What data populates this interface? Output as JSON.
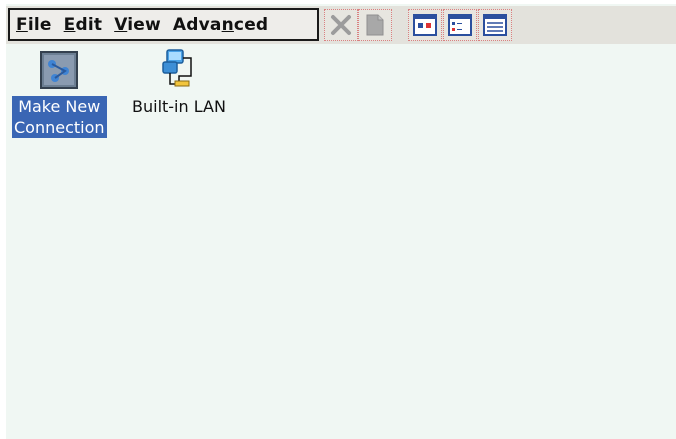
{
  "menu": {
    "file": {
      "pre": "",
      "u": "F",
      "post": "ile"
    },
    "edit": {
      "pre": "",
      "u": "E",
      "post": "dit"
    },
    "view": {
      "pre": "",
      "u": "V",
      "post": "iew"
    },
    "advanced": {
      "pre": "Adva",
      "u": "n",
      "post": "ced"
    }
  },
  "toolbar": {
    "buttons": [
      {
        "icon": "delete-icon",
        "enabled": false
      },
      {
        "icon": "properties-icon",
        "enabled": false
      },
      {
        "icon": "large-icons-view-icon",
        "enabled": true
      },
      {
        "icon": "small-icons-view-icon",
        "enabled": true
      },
      {
        "icon": "details-view-icon",
        "enabled": true
      }
    ]
  },
  "items": [
    {
      "line1": "Make New",
      "line2": "Connection",
      "icon": "make-new-connection-icon",
      "selected": true
    },
    {
      "line1": "Built-in LAN",
      "line2": "",
      "icon": "network-lan-icon",
      "selected": false
    }
  ],
  "colors": {
    "selection": "#3a66b4",
    "content_background": "#f0f7f3",
    "menubar_background": "#e3e2dc"
  }
}
